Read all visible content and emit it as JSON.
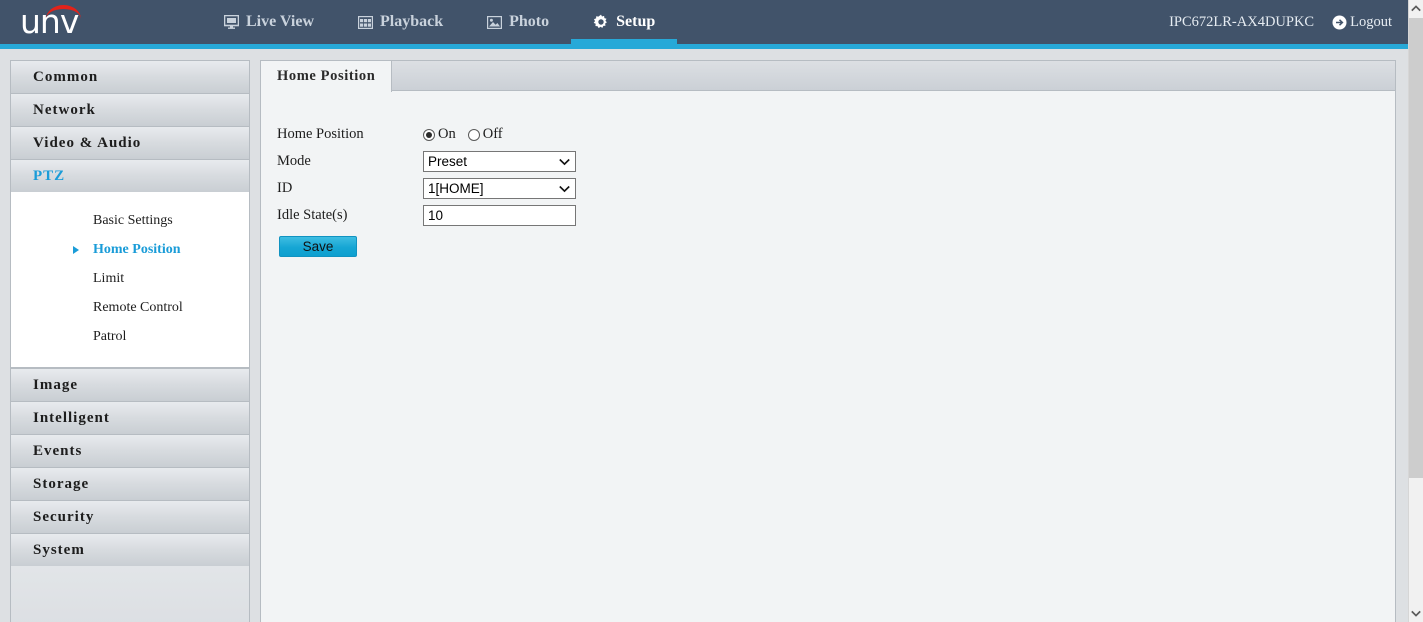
{
  "header": {
    "logo_text": "unv",
    "nav": [
      {
        "label": "Live View",
        "icon": "monitor-icon",
        "active": false
      },
      {
        "label": "Playback",
        "icon": "film-icon",
        "active": false
      },
      {
        "label": "Photo",
        "icon": "image-icon",
        "active": false
      },
      {
        "label": "Setup",
        "icon": "gear-icon",
        "active": true
      }
    ],
    "device_name": "IPC672LR-AX4DUPKC",
    "logout_label": "Logout",
    "bg_color": "#41536a",
    "accent_color": "#27a9d8"
  },
  "sidebar": {
    "groups": [
      {
        "label": "Common",
        "active": false
      },
      {
        "label": "Network",
        "active": false
      },
      {
        "label": "Video & Audio",
        "active": false
      },
      {
        "label": "PTZ",
        "active": true
      }
    ],
    "submenu": [
      {
        "label": "Basic Settings",
        "active": false
      },
      {
        "label": "Home Position",
        "active": true
      },
      {
        "label": "Limit",
        "active": false
      },
      {
        "label": "Remote Control",
        "active": false
      },
      {
        "label": "Patrol",
        "active": false
      }
    ],
    "groups_after": [
      {
        "label": "Image",
        "active": false
      },
      {
        "label": "Intelligent",
        "active": false
      },
      {
        "label": "Events",
        "active": false
      },
      {
        "label": "Storage",
        "active": false
      },
      {
        "label": "Security",
        "active": false
      },
      {
        "label": "System",
        "active": false
      }
    ],
    "active_color": "#1a9cd8"
  },
  "content": {
    "tab_label": "Home Position",
    "form": {
      "home_position": {
        "label": "Home Position",
        "on_label": "On",
        "off_label": "Off",
        "value": "On"
      },
      "mode": {
        "label": "Mode",
        "value": "Preset"
      },
      "id": {
        "label": "ID",
        "value": "1[HOME]"
      },
      "idle_state": {
        "label": "Idle State(s)",
        "value": "10"
      },
      "save_label": "Save",
      "save_color": "#16a6d4"
    }
  }
}
